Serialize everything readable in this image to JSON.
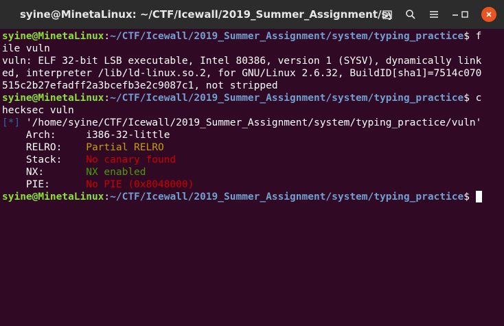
{
  "window": {
    "title": "syine@MinetaLinux: ~/CTF/Icewall/2019_Summer_Assignment/syste...",
    "buttons": [
      "new-tab-icon",
      "search-icon",
      "menu-icon",
      "minimize-icon",
      "maximize-icon",
      "close-icon"
    ]
  },
  "colors": {
    "background": "#300a24",
    "prompt_user": "#8ae234",
    "prompt_path": "#729fcf",
    "partial": "#c4a000",
    "bad": "#cc0000",
    "good": "#4e9a06",
    "close_button": "#e95420"
  },
  "terminal": {
    "p1_user": "syine@MinetaLinux",
    "p1_colon": ":",
    "p1_path": "~/CTF/Icewall/2019_Summer_Assignment/system/typing_practice",
    "p1_dollar": "$ f",
    "l2": "ile vuln",
    "l3": "vuln: ELF 32-bit LSB executable, Intel 80386, version 1 (SYSV), dynamically link",
    "l4": "ed, interpreter /lib/ld-linux.so.2, for GNU/Linux 2.6.32, BuildID[sha1]=7514c070",
    "l5": "515c2b27efadff2a3bcefb3e2c9087c1, not stripped",
    "p2_user": "syine@MinetaLinux",
    "p2_colon": ":",
    "p2_path": "~/CTF/Icewall/2019_Summer_Assignment/system/typing_practice",
    "p2_dollar": "$ c",
    "l7": "hecksec vuln",
    "l8_bracket": "[*]",
    "l8_text": " '/home/syine/CTF/Icewall/2019_Summer_Assignment/system/typing_practice/vuln'",
    "arch_key": "    Arch:     ",
    "arch_val": "i386-32-little",
    "relro_key": "    RELRO:    ",
    "relro_val": "Partial RELRO",
    "stack_key": "    Stack:    ",
    "stack_val": "No canary found",
    "nx_key": "    NX:       ",
    "nx_val": "NX enabled",
    "pie_key": "    PIE:      ",
    "pie_val": "No PIE (0x8048000)",
    "p3_user": "syine@MinetaLinux",
    "p3_colon": ":",
    "p3_path": "~/CTF/Icewall/2019_Summer_Assignment/system/typing_practice",
    "p3_dollar": "$ "
  }
}
